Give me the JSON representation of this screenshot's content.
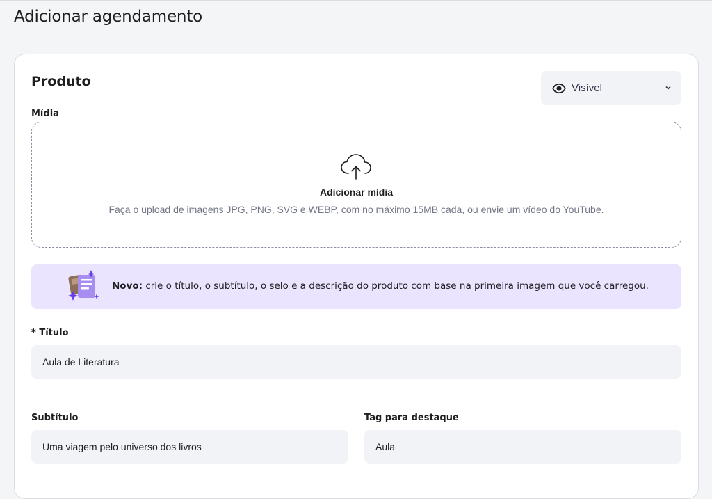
{
  "page": {
    "title": "Adicionar agendamento"
  },
  "card": {
    "title": "Produto",
    "visibility": {
      "value": "Visível",
      "icon": "eye-icon"
    },
    "media": {
      "label": "Mídia",
      "upload_title": "Adicionar mídia",
      "upload_description": "Faça o upload de imagens JPG, PNG, SVG e WEBP, com no máximo 15MB cada, ou envie um vídeo do YouTube.",
      "icon": "cloud-upload-icon"
    },
    "ai_banner": {
      "strong": "Novo:",
      "text": " crie o título, o subtítulo, o selo e a descrição do produto com base na primeira imagem que você carregou."
    },
    "fields": {
      "title": {
        "label": "* Título",
        "value": "Aula de Literatura"
      },
      "subtitle": {
        "label": "Subtítulo",
        "value": "Uma viagem pelo universo dos livros"
      },
      "tag": {
        "label": "Tag para destaque",
        "value": "Aula"
      }
    }
  },
  "colors": {
    "background": "#f4f5f7",
    "card": "#ffffff",
    "input": "#f2f3f6",
    "banner": "#ebe4ff",
    "accent": "#673de6",
    "muted_text": "#727586"
  }
}
